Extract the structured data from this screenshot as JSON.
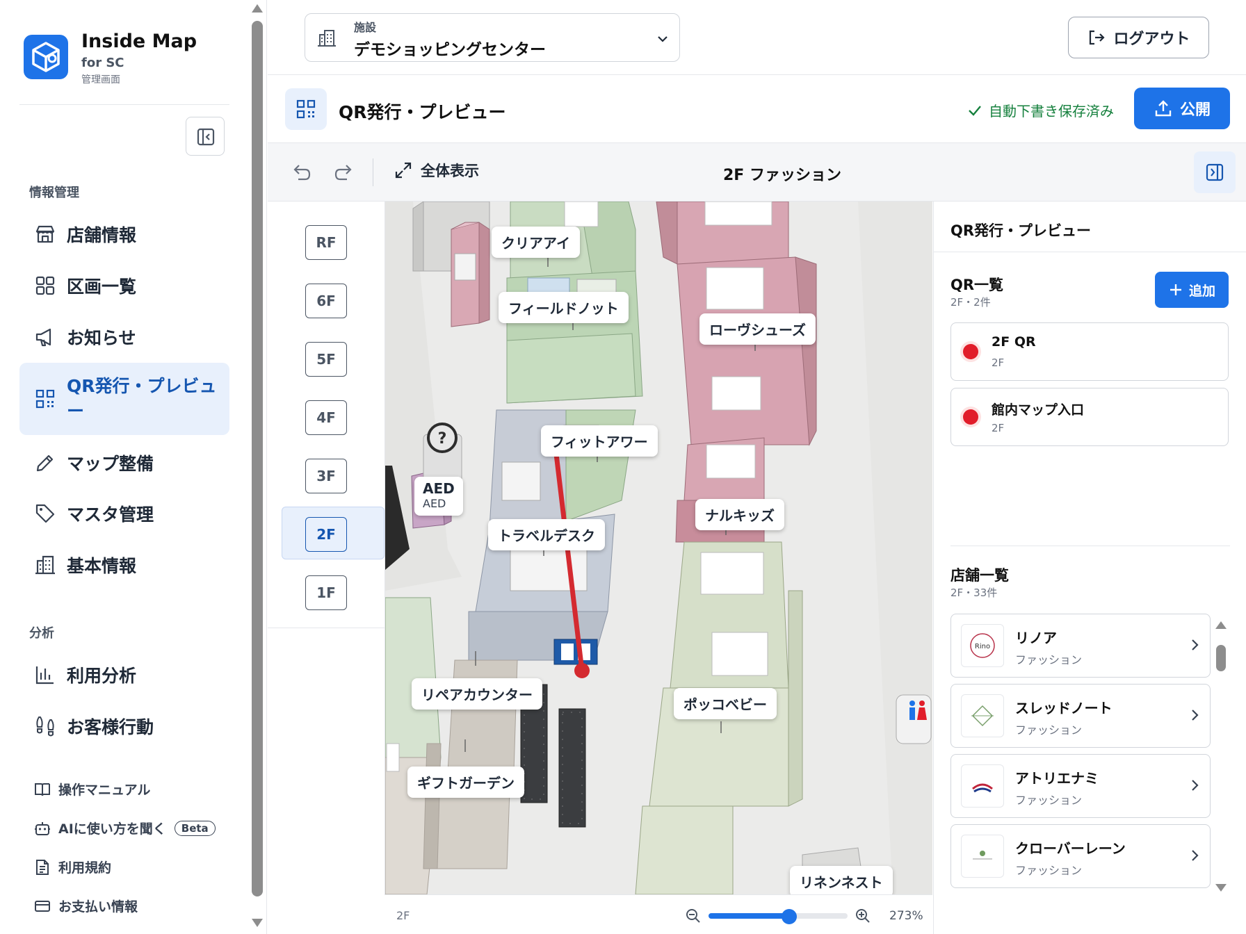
{
  "app": {
    "name": "Inside Map",
    "subtitle": "for SC",
    "subtitle2": "管理画面"
  },
  "sidebar": {
    "section_info": "情報管理",
    "section_analysis": "分析",
    "items": [
      {
        "label": "店舗情報",
        "icon": "store-icon"
      },
      {
        "label": "区画一覧",
        "icon": "grid-icon"
      },
      {
        "label": "お知らせ",
        "icon": "megaphone-icon"
      },
      {
        "label": "QR発行・プレビュー",
        "icon": "qr-icon",
        "active": true
      },
      {
        "label": "マップ整備",
        "icon": "pencil-icon"
      },
      {
        "label": "マスタ管理",
        "icon": "tag-icon"
      },
      {
        "label": "基本情報",
        "icon": "building-icon"
      }
    ],
    "analysis_items": [
      {
        "label": "利用分析",
        "icon": "bar-chart-icon"
      },
      {
        "label": "お客様行動",
        "icon": "footprints-icon"
      }
    ],
    "footer_items": [
      {
        "label": "操作マニュアル",
        "icon": "book-icon"
      },
      {
        "label": "AIに使い方を聞く",
        "icon": "robot-icon",
        "badge": "Beta"
      },
      {
        "label": "利用規約",
        "icon": "document-icon"
      },
      {
        "label": "お支払い情報",
        "icon": "credit-card-icon"
      }
    ]
  },
  "header": {
    "facility_label": "施設",
    "facility_value": "デモショッピングセンター",
    "logout_label": "ログアウト"
  },
  "page": {
    "title": "QR発行・プレビュー",
    "save_status": "自動下書き保存済み",
    "publish_label": "公開"
  },
  "toolbar": {
    "fit_label": "全体表示",
    "floor_title": "2F ファッション"
  },
  "floors": [
    "RF",
    "6F",
    "5F",
    "4F",
    "3F",
    "2F",
    "1F"
  ],
  "active_floor": "2F",
  "map": {
    "callouts": {
      "clearai": "クリアアイ",
      "fieldknot": "フィールドノット",
      "rovshoes": "ローヴシューズ",
      "fitawa": "フィットアワー",
      "aed_title": "AED",
      "aed_sub": "AED",
      "narukids": "ナルキッズ",
      "travel": "トラベルデスク",
      "repair": "リペアカウンター",
      "pokkobaby": "ポッコベビー",
      "gift": "ギフトガーデン",
      "rinennest": "リネンネスト"
    },
    "footer_floor": "2F",
    "zoom": "273%",
    "zoom_level": 0.58
  },
  "right_panel": {
    "title": "QR発行・プレビュー",
    "qr_heading": "QR一覧",
    "qr_sub": "2F・2件",
    "add_label": "追加",
    "qr_items": [
      {
        "name": "2F QR",
        "floor": "2F"
      },
      {
        "name": "館内マップ入口",
        "floor": "2F"
      }
    ],
    "shop_heading": "店舗一覧",
    "shop_sub": "2F・33件",
    "shops": [
      {
        "name": "リノア",
        "category": "ファッション"
      },
      {
        "name": "スレッドノート",
        "category": "ファッション"
      },
      {
        "name": "アトリエナミ",
        "category": "ファッション"
      },
      {
        "name": "クローバーレーン",
        "category": "ファッション"
      }
    ]
  },
  "colors": {
    "accent": "#1e73e8",
    "active_bg": "#e8f0fc",
    "saved_green": "#15803d",
    "qr_dot": "#e11d2a"
  }
}
